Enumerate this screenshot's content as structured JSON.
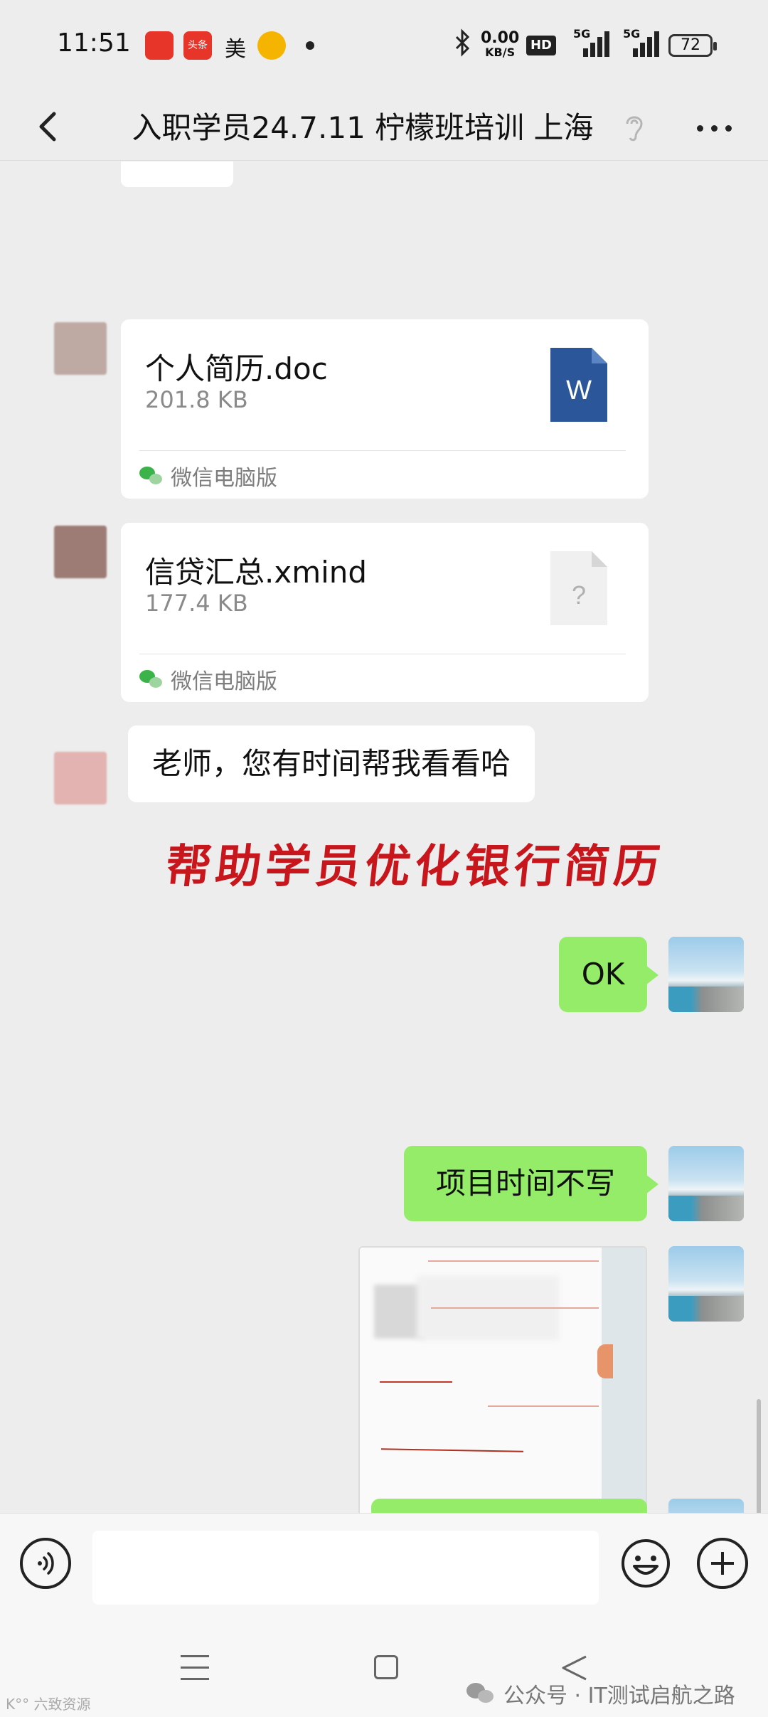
{
  "status_bar": {
    "time": "11:51",
    "notif_app_text": "头条",
    "notif_text": "美",
    "data_speed_value": "0.00",
    "data_speed_unit": "KB/S",
    "hd_label": "HD",
    "network_1": "5G",
    "network_2": "5G",
    "battery": "72"
  },
  "header": {
    "title": "入职学员24.7.11 柠檬班培训 上海"
  },
  "messages": {
    "file_1": {
      "name": "个人简历.doc",
      "size": "201.8 KB",
      "type_badge": "W",
      "source": "微信电脑版",
      "icon": "word-doc-icon"
    },
    "file_2": {
      "name": "信贷汇总.xmind",
      "size": "177.4 KB",
      "type_badge": "?",
      "source": "微信电脑版",
      "icon": "unknown-file-icon"
    },
    "text_left": "老师，您有时间帮我看看哈",
    "overlay_caption": "帮助学员优化银行简历",
    "reply_ok": "OK",
    "reply_time": "项目时间不写"
  },
  "input_bar": {
    "placeholder": ""
  },
  "watermark": {
    "label": "公众号 · IT测试启航之路",
    "corner": "K°° 六致资源"
  },
  "colors": {
    "bubble_self": "#95ec69",
    "caption_red": "#c8161d",
    "word_blue": "#2b579a",
    "background": "#ededed"
  }
}
